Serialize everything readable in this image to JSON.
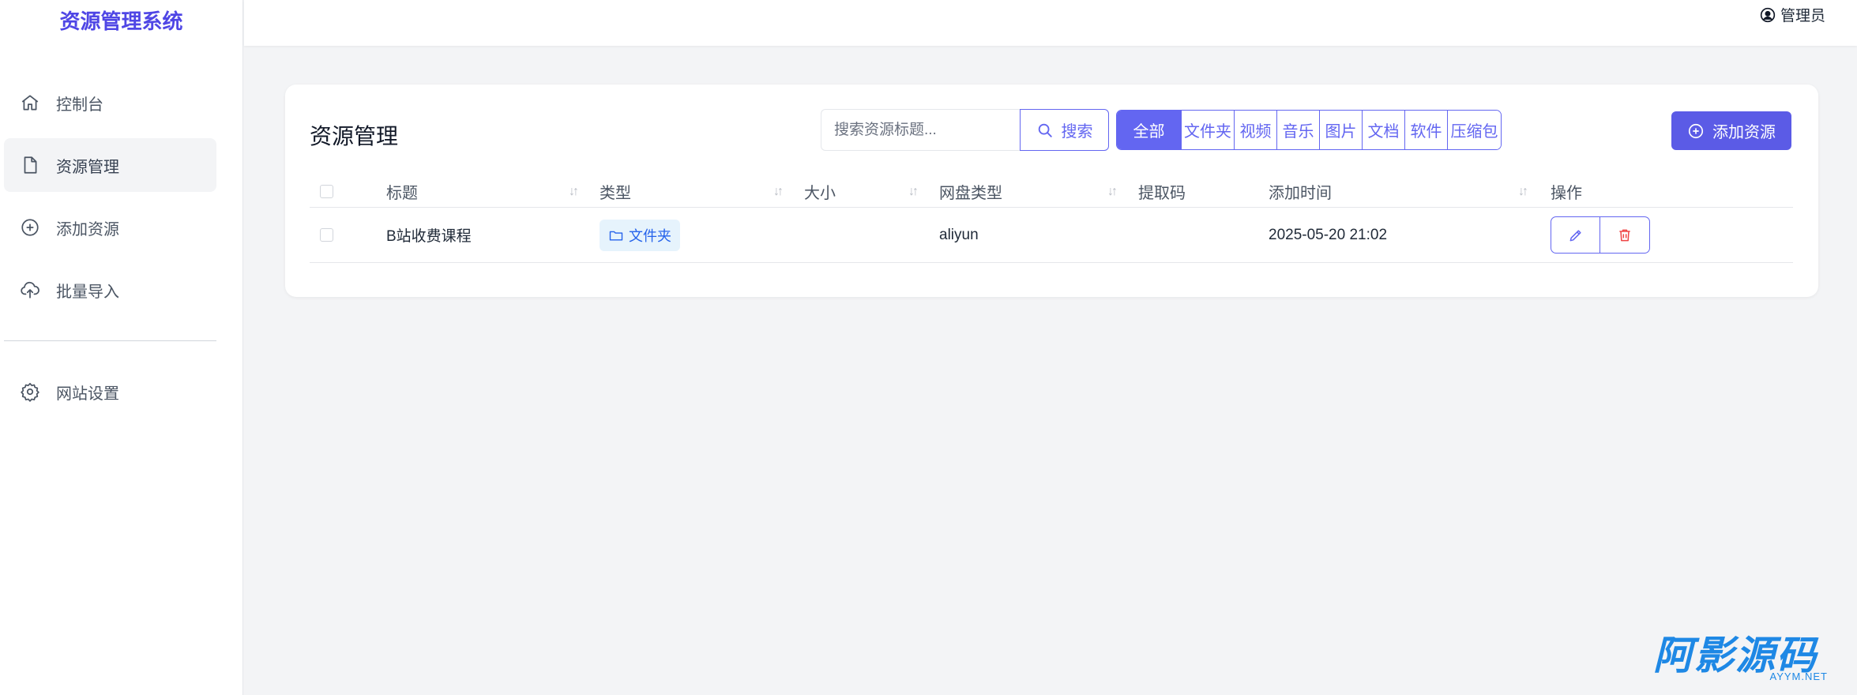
{
  "app": {
    "title": "资源管理系统"
  },
  "sidebar": {
    "items": [
      {
        "label": "控制台",
        "icon": "home-icon",
        "active": false
      },
      {
        "label": "资源管理",
        "icon": "file-icon",
        "active": true
      },
      {
        "label": "添加资源",
        "icon": "plus-circle-icon",
        "active": false
      },
      {
        "label": "批量导入",
        "icon": "cloud-upload-icon",
        "active": false
      }
    ],
    "settings": {
      "label": "网站设置",
      "icon": "gear-icon"
    }
  },
  "header": {
    "user_label": "管理员",
    "user_icon": "user-circle-icon"
  },
  "main": {
    "title": "资源管理",
    "search": {
      "placeholder": "搜索资源标题...",
      "value": "",
      "button_label": "搜索"
    },
    "filters": [
      "全部",
      "文件夹",
      "视频",
      "音乐",
      "图片",
      "文档",
      "软件",
      "压缩包"
    ],
    "active_filter": "全部",
    "add_button_label": "添加资源",
    "table": {
      "columns": [
        "标题",
        "类型",
        "大小",
        "网盘类型",
        "提取码",
        "添加时间",
        "操作"
      ],
      "rows": [
        {
          "title": "B站收费课程",
          "type": "文件夹",
          "size": "",
          "pan_type": "aliyun",
          "code": "",
          "added": "2025-05-20 21:02"
        }
      ]
    }
  },
  "watermark": {
    "main": "阿影源码",
    "sub": "AYYM.NET"
  },
  "colors": {
    "accent": "#6366f1",
    "brand": "#4f46e5",
    "danger": "#ef4444",
    "tag_bg": "#e6f3fc"
  }
}
